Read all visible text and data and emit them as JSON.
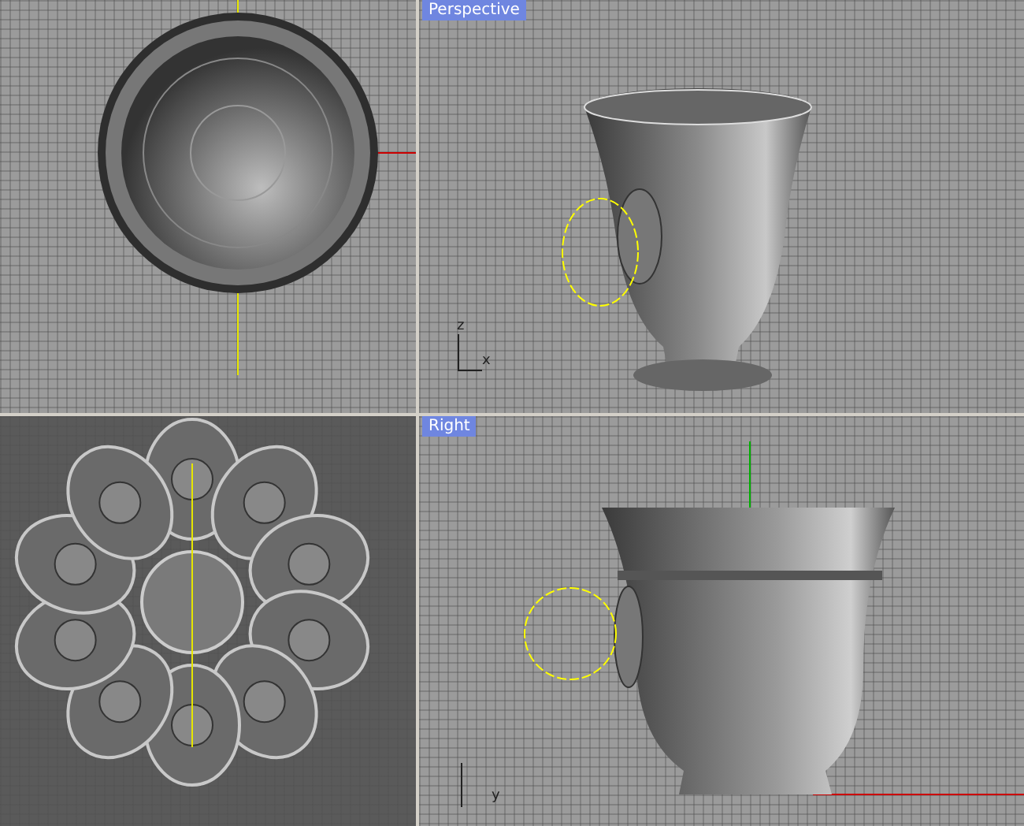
{
  "viewports": [
    {
      "kind": "top"
    },
    {
      "kind": "perspective",
      "label": "Perspective",
      "axis_labels": [
        "z",
        "x"
      ]
    },
    {
      "kind": "detail"
    },
    {
      "kind": "right",
      "label": "Right",
      "axis_labels": [
        "y"
      ]
    }
  ]
}
